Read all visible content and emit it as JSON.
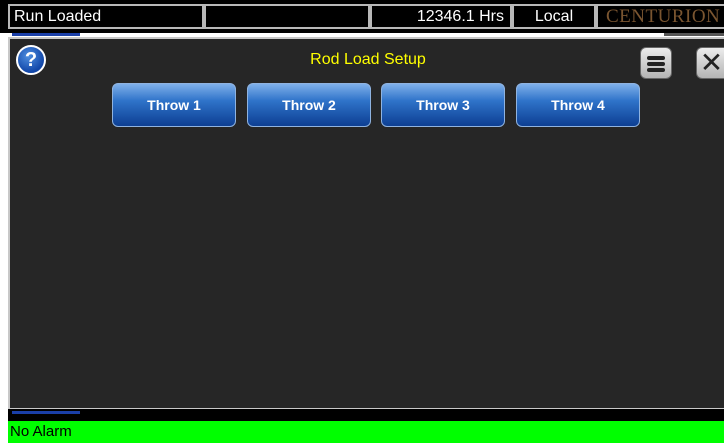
{
  "header": {
    "status": "Run Loaded",
    "blank": "",
    "hours": "12346.1 Hrs",
    "mode": "Local",
    "brand": "CENTURION"
  },
  "panel": {
    "title": "Rod Load Setup",
    "help_icon": "question-mark-icon",
    "menu_icon": "menu-icon",
    "close_icon": "close-icon",
    "help_glyph": "?",
    "close_glyph": "✕"
  },
  "throws": [
    {
      "label": "Throw 1"
    },
    {
      "label": "Throw 2"
    },
    {
      "label": "Throw 3"
    },
    {
      "label": "Throw 4"
    }
  ],
  "footer": {
    "alarm": "No Alarm",
    "alarm_color": "#00ff00"
  },
  "colors": {
    "title": "#ffff00",
    "panel_bg": "#262626",
    "button_blue": "#1f5fb8"
  }
}
